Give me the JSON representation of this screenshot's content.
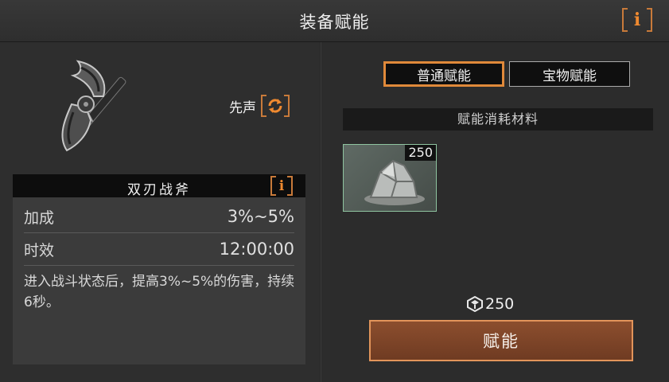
{
  "header": {
    "title": "装备赋能",
    "info_glyph": "i"
  },
  "item": {
    "sound_label": "先声",
    "name": "双刃战斧",
    "info_glyph": "i",
    "stats": [
      {
        "label": "加成",
        "value": "3%~5%"
      },
      {
        "label": "时效",
        "value": "12:00:00"
      }
    ],
    "description": "进入战斗状态后，提高3%~5%的伤害，持续6秒。"
  },
  "tabs": {
    "normal": "普通赋能",
    "treasure": "宝物赋能",
    "active": "normal"
  },
  "materials": {
    "header": "赋能消耗材料",
    "items": [
      {
        "icon": "ore-icon",
        "count": "250"
      }
    ]
  },
  "cost": {
    "icon": "coin-icon",
    "amount": "250"
  },
  "action": {
    "label": "赋能"
  },
  "colors": {
    "accent": "#e0893a",
    "background": "#2a2a2a",
    "button": "#7c4428"
  }
}
